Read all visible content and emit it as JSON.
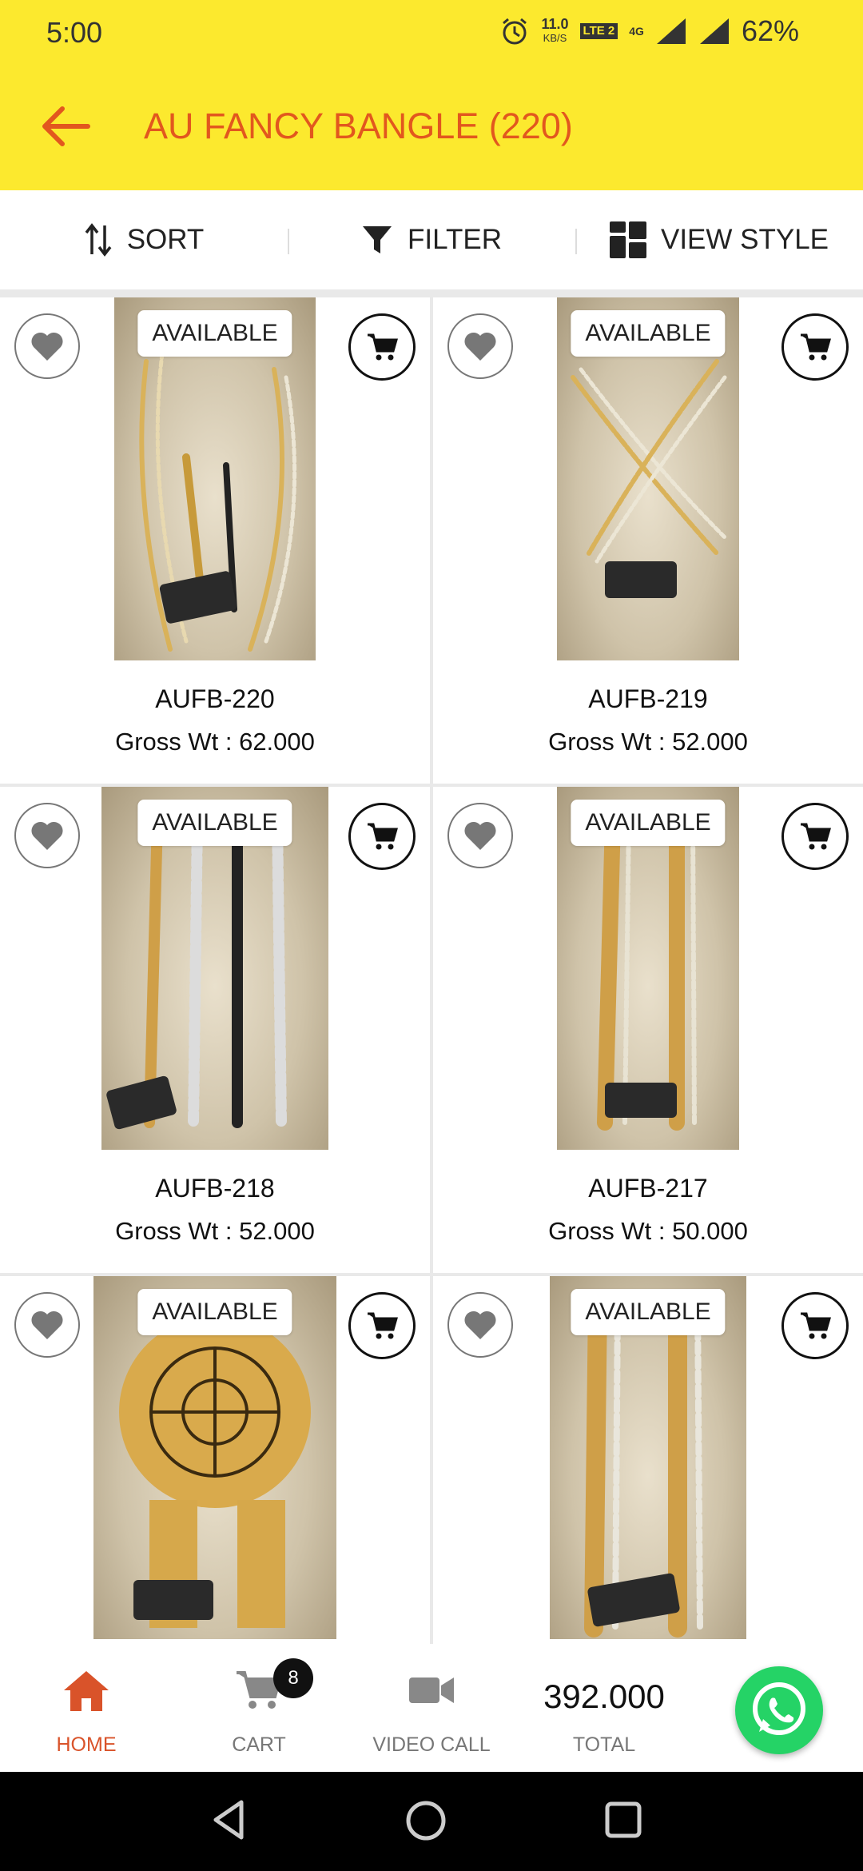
{
  "status_bar": {
    "time": "5:00",
    "net_speed_value": "11.0",
    "net_speed_unit": "KB/S",
    "network": "4G",
    "volte": "LTE 2",
    "battery": "62%"
  },
  "header": {
    "title": "AU FANCY BANGLE (220)"
  },
  "toolbar": {
    "sort": "SORT",
    "filter": "FILTER",
    "view_style": "VIEW STYLE"
  },
  "products": [
    {
      "code": "AUFB-220",
      "gross": "Gross Wt : 62.000",
      "status": "AVAILABLE"
    },
    {
      "code": "AUFB-219",
      "gross": "Gross Wt : 52.000",
      "status": "AVAILABLE"
    },
    {
      "code": "AUFB-218",
      "gross": "Gross Wt : 52.000",
      "status": "AVAILABLE"
    },
    {
      "code": "AUFB-217",
      "gross": "Gross Wt : 50.000",
      "status": "AVAILABLE"
    },
    {
      "status": "AVAILABLE"
    },
    {
      "status": "AVAILABLE"
    }
  ],
  "bottom_nav": {
    "home": "HOME",
    "cart": "CART",
    "cart_count": "8",
    "video_call": "VIDEO CALL",
    "total_value": "392.000",
    "total_label": "TOTAL"
  },
  "colors": {
    "header_bg": "#fce92e",
    "accent": "#e2571e",
    "whatsapp": "#25d366"
  }
}
